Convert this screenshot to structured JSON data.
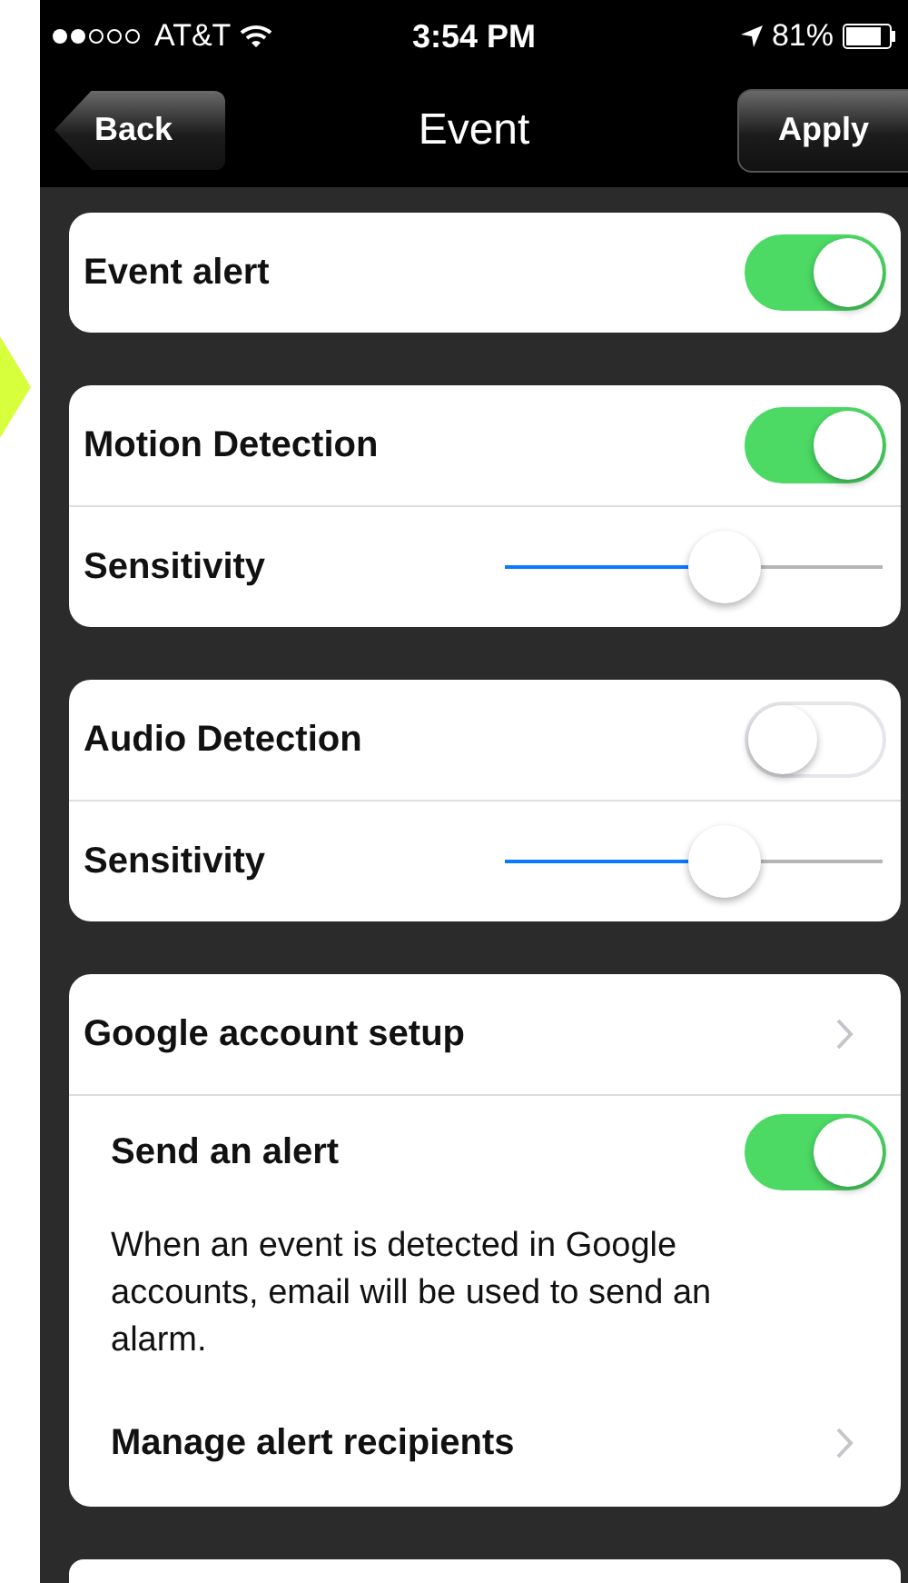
{
  "status_bar": {
    "carrier": "AT&T",
    "time": "3:54 PM",
    "battery": "81%"
  },
  "nav_bar": {
    "back": "Back",
    "title": "Event",
    "action": "Apply"
  },
  "sections": [
    {
      "rows": [
        {
          "kind": "toggle",
          "label": "Event alert",
          "on": true
        }
      ]
    },
    {
      "rows": [
        {
          "kind": "toggle",
          "label": "Motion Detection",
          "on": true
        },
        {
          "kind": "slider",
          "label": "Sensitivity",
          "level": 0.58
        }
      ]
    },
    {
      "rows": [
        {
          "kind": "toggle",
          "label": "Audio Detection",
          "on": false
        },
        {
          "kind": "slider",
          "label": "Sensitivity",
          "level": 0.58
        }
      ]
    },
    {
      "rows": [
        {
          "kind": "link",
          "label": "Google account setup",
          "children": [
            {
              "kind": "toggle",
              "label": "Send an alert",
              "on": true
            },
            {
              "kind": "note",
              "label": "When an event is detected in Google accounts, email will be used to send an alarm."
            },
            {
              "kind": "link",
              "label": "Manage alert recipients"
            }
          ]
        }
      ]
    }
  ]
}
